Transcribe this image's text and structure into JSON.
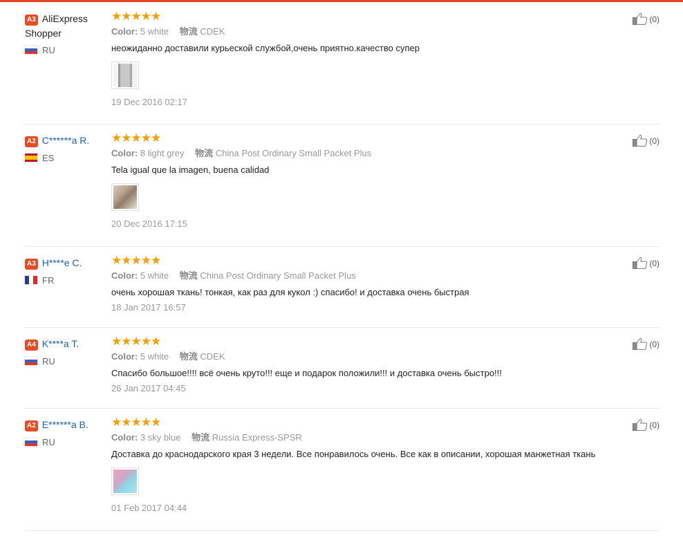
{
  "reviews": [
    {
      "level": "A3",
      "name_line1": "AliExpress",
      "name_line2": "Shopper",
      "country": "RU",
      "stars": "★★★★★",
      "color_label": "Color:",
      "color_value": "5 white",
      "logistics_label": "物流",
      "logistics_value": "CDEK",
      "text": "неожиданно доставили курьеской службой,очень приятно.качество супер",
      "has_image": true,
      "date": "19 Dec 2016 02:17",
      "helpful": "(0)"
    },
    {
      "level": "A2",
      "name": "C******a R.",
      "country": "ES",
      "stars": "★★★★★",
      "color_label": "Color:",
      "color_value": "8 light grey",
      "logistics_label": "物流",
      "logistics_value": "China Post Ordinary Small Packet Plus",
      "text": "Tela igual que la imagen, buena calidad",
      "has_image": true,
      "date": "20 Dec 2016 17:15",
      "helpful": "(0)"
    },
    {
      "level": "A3",
      "name": "H****e C.",
      "country": "FR",
      "stars": "★★★★★",
      "color_label": "Color:",
      "color_value": "5 white",
      "logistics_label": "物流",
      "logistics_value": "China Post Ordinary Small Packet Plus",
      "text": "очень хорошая ткань! тонкая, как раз для кукол :) спасибо! и доставка очень быстрая",
      "has_image": false,
      "date": "18 Jan 2017 16:57",
      "helpful": "(0)"
    },
    {
      "level": "A4",
      "name": "K****a T.",
      "country": "RU",
      "stars": "★★★★★",
      "color_label": "Color:",
      "color_value": "5 white",
      "logistics_label": "物流",
      "logistics_value": "CDEK",
      "text": "Спасибо большое!!!! всё очень круто!!! еще и подарок положили!!! и доставка очень быстро!!!",
      "has_image": false,
      "date": "26 Jan 2017 04:45",
      "helpful": "(0)"
    },
    {
      "level": "A2",
      "name": "E******a B.",
      "country": "RU",
      "stars": "★★★★★",
      "color_label": "Color:",
      "color_value": "3 sky blue",
      "logistics_label": "物流",
      "logistics_value": "Russia Express-SPSR",
      "text": "Доставка до краснодарского края 3 недели. Все понравилось очень. Все как в описании, хорошая манжетная ткань",
      "has_image": true,
      "date": "01 Feb 2017 04:44",
      "helpful": "(0)"
    }
  ],
  "colors": {
    "accent": "#e8411e",
    "star": "#f59f00",
    "username": "#1f5fa8",
    "level_badge": "#e44d26"
  }
}
